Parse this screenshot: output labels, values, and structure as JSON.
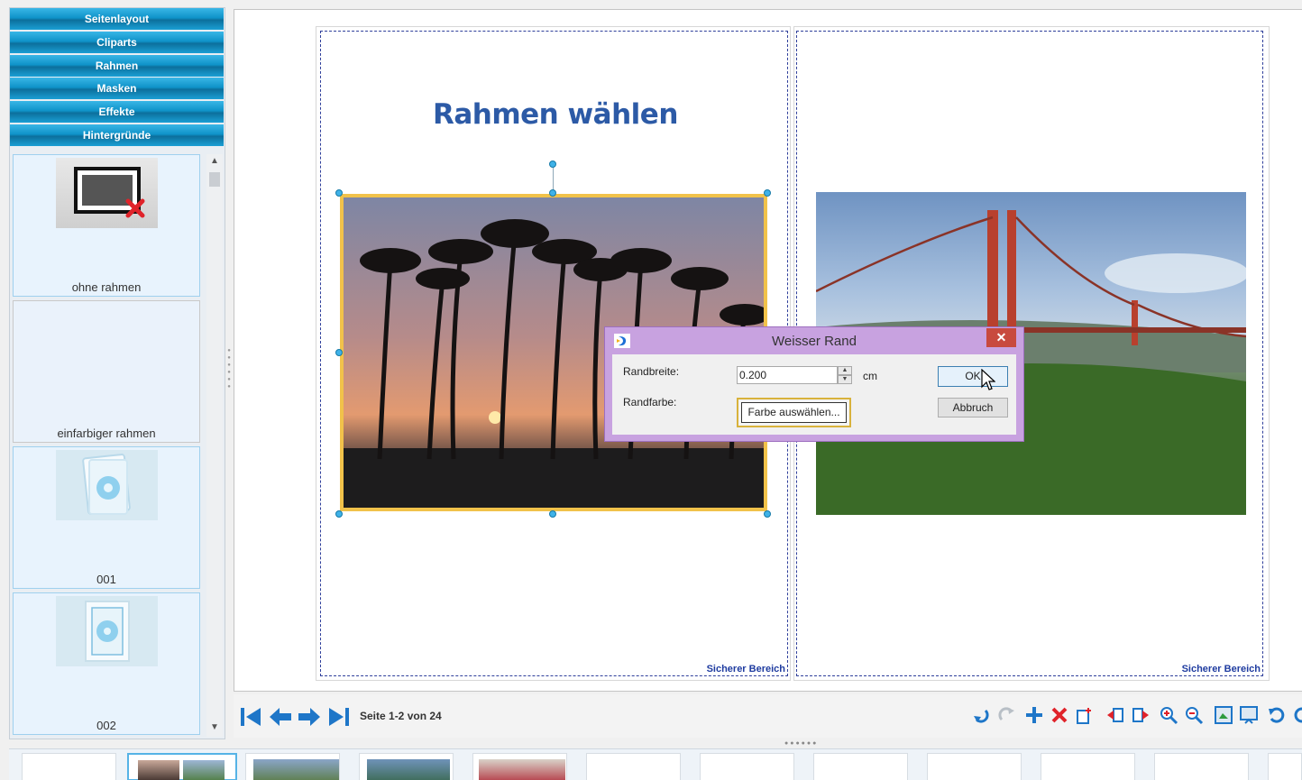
{
  "sidebar": {
    "categories": [
      "Seitenlayout",
      "Cliparts",
      "Rahmen",
      "Masken",
      "Effekte",
      "Hintergründe"
    ],
    "frames": [
      {
        "label": "ohne rahmen",
        "icon": "no-frame-icon"
      },
      {
        "label": "einfarbiger rahmen",
        "icon": "none"
      },
      {
        "label": "001",
        "icon": "frame-001-thumbnail"
      },
      {
        "label": "002",
        "icon": "frame-002-thumbnail"
      }
    ]
  },
  "canvas": {
    "heading": "Rahmen wählen",
    "safe_area_label": "Sicherer Bereich"
  },
  "dialog": {
    "title": "Weisser Rand",
    "close_label": "✕",
    "randbreite_label": "Randbreite:",
    "randbreite_value": "0.200",
    "unit": "cm",
    "randfarbe_label": "Randfarbe:",
    "color_button_label": "Farbe auswählen...",
    "ok_label": "OK",
    "cancel_label": "Abbruch"
  },
  "navigation": {
    "page_info": "Seite 1-2 von 24"
  },
  "colors": {
    "category_button": "#0f93c9",
    "heading": "#2c5aa6",
    "dialog_frame": "#c8a2e0",
    "selection": "#f1c24a",
    "handle": "#3fb2e8"
  }
}
